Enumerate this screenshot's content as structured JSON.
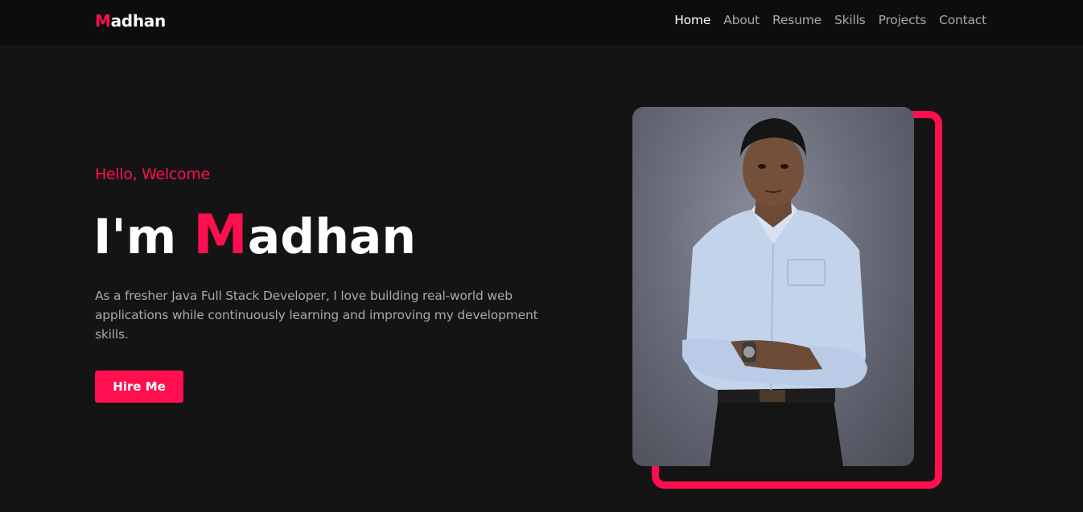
{
  "logo": {
    "initial": "M",
    "rest": "adhan"
  },
  "nav": {
    "items": [
      {
        "label": "Home",
        "active": true
      },
      {
        "label": "About",
        "active": false
      },
      {
        "label": "Resume",
        "active": false
      },
      {
        "label": "Skills",
        "active": false
      },
      {
        "label": "Projects",
        "active": false
      },
      {
        "label": "Contact",
        "active": false
      }
    ]
  },
  "hero": {
    "greeting": "Hello, Welcome",
    "headline_prefix": "I'm ",
    "headline_initial": "M",
    "headline_rest": "adhan",
    "intro": "As a fresher Java Full Stack Developer, I love building real-world web applications while continuously learning and improving my development skills.",
    "cta_label": "Hire Me"
  },
  "colors": {
    "accent": "#ff0f4f",
    "background": "#141414",
    "navbar": "#0d0d0d",
    "muted_text": "#a9a9a9"
  }
}
